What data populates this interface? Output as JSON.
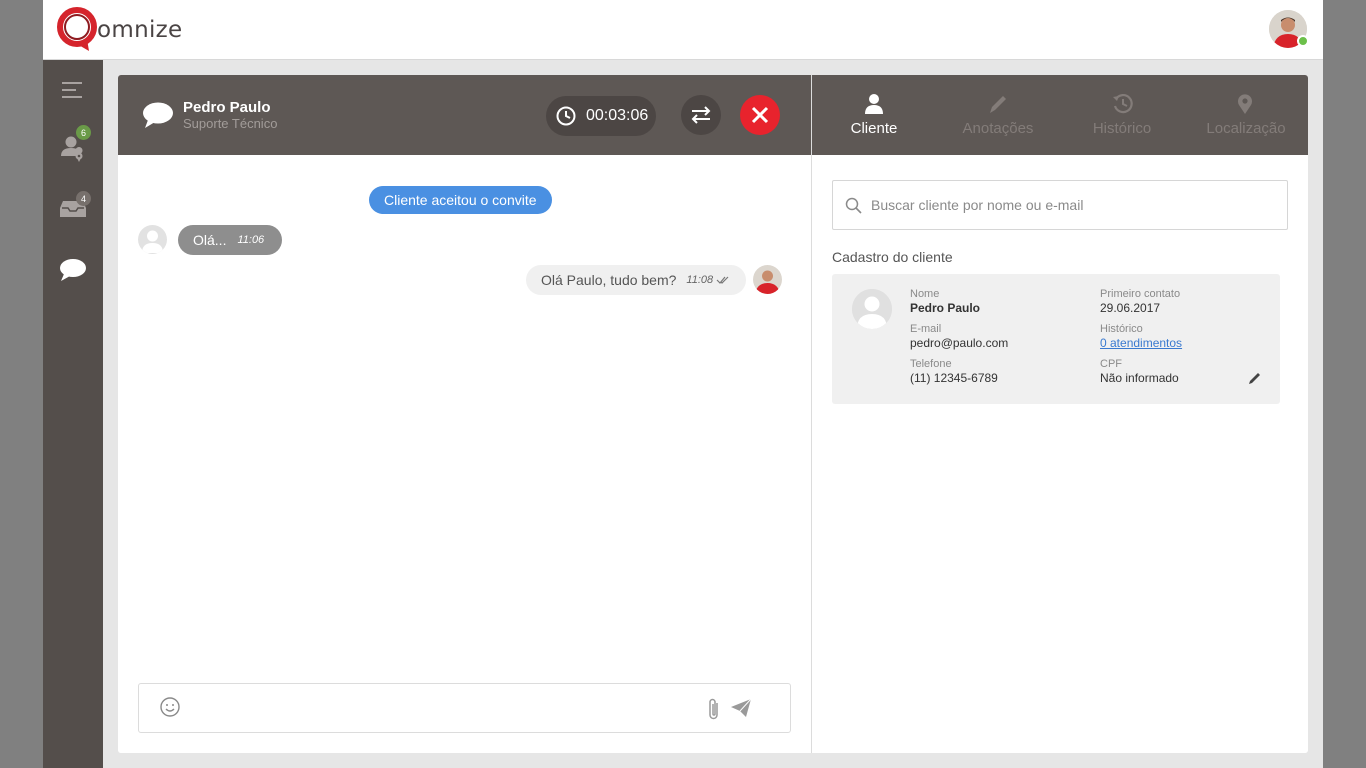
{
  "app": {
    "brand": "omnize"
  },
  "sidebar": {
    "items": [
      {
        "icon": "menu-icon"
      },
      {
        "icon": "user-location-icon",
        "badge": "6",
        "badge_color": "#6a9a48"
      },
      {
        "icon": "inbox-icon",
        "badge": "4",
        "badge_color": "#77706c"
      },
      {
        "icon": "chat-bubble-icon"
      }
    ]
  },
  "conversation": {
    "name": "Pedro Paulo",
    "department": "Suporte Técnico",
    "timer": "00:03:06"
  },
  "tabs": [
    {
      "label": "Cliente",
      "icon": "person-icon",
      "active": true
    },
    {
      "label": "Anotações",
      "icon": "pencil-icon",
      "active": false
    },
    {
      "label": "Histórico",
      "icon": "history-icon",
      "active": false
    },
    {
      "label": "Localização",
      "icon": "location-pin-icon",
      "active": false
    }
  ],
  "chat": {
    "system_message": "Cliente aceitou o convite",
    "messages": [
      {
        "direction": "in",
        "text": "Olá...",
        "time": "11:06"
      },
      {
        "direction": "out",
        "text": "Olá Paulo, tudo bem?",
        "time": "11:08",
        "status": "read"
      }
    ]
  },
  "client": {
    "search_placeholder": "Buscar cliente por nome ou e-mail",
    "section_title": "Cadastro do cliente",
    "fields": {
      "name_label": "Nome",
      "name_value": "Pedro Paulo",
      "first_contact_label": "Primeiro contato",
      "first_contact_value": "29.06.2017",
      "email_label": "E-mail",
      "email_value": "pedro@paulo.com",
      "history_label": "Histórico",
      "history_value": "0 atendimentos",
      "phone_label": "Telefone",
      "phone_value": "(11) 12345-6789",
      "cpf_label": "CPF",
      "cpf_value": "Não informado"
    }
  },
  "colors": {
    "header_bg": "#5e5855",
    "sidebar_bg": "#544e4b",
    "accent_blue": "#4a90e2",
    "danger_red": "#e8232d",
    "online_green": "#6cc04a"
  }
}
